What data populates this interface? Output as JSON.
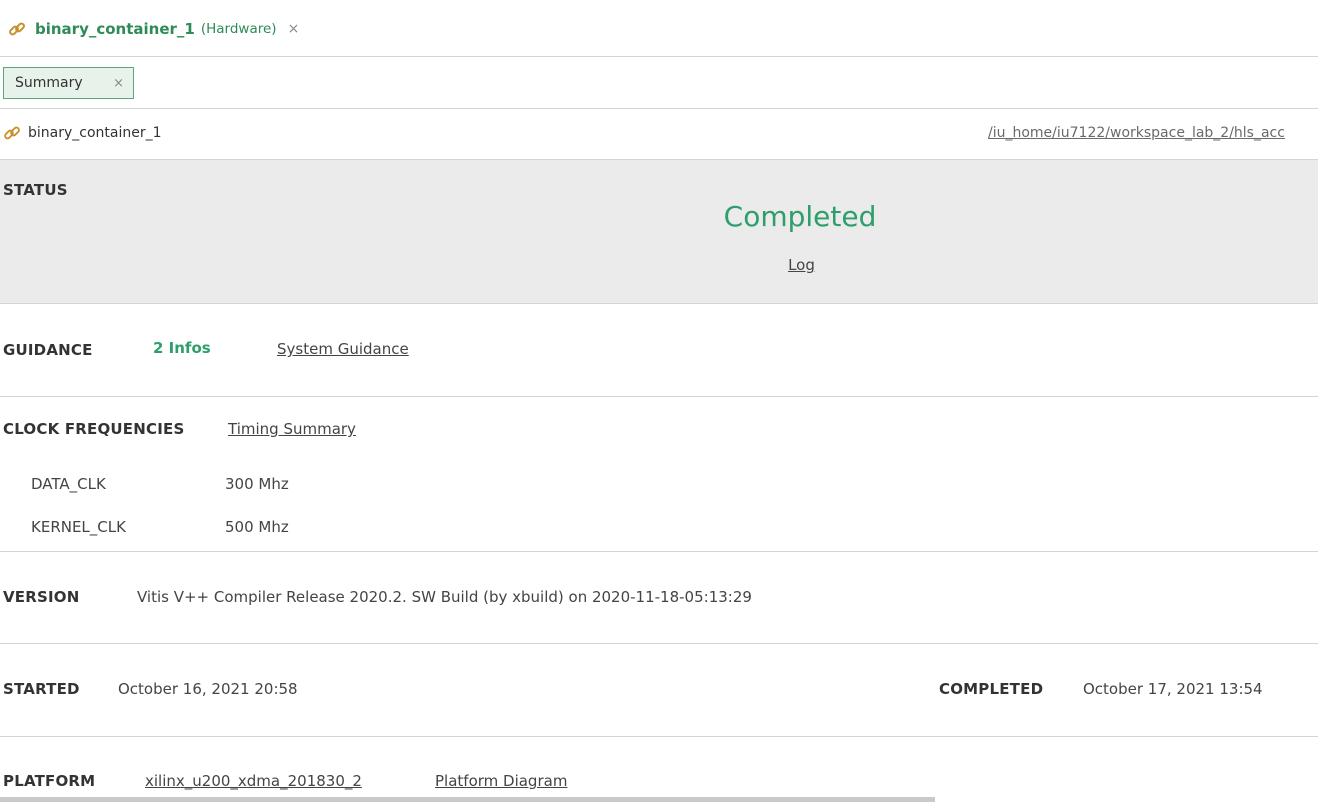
{
  "editor_tab": {
    "title": "binary_container_1",
    "kind": "(Hardware)",
    "close": "×"
  },
  "subtab": {
    "label": "Summary",
    "close": "×"
  },
  "path_row": {
    "name": "binary_container_1",
    "path": "/iu_home/iu7122/workspace_lab_2/hls_acc"
  },
  "status": {
    "label": "STATUS",
    "value": "Completed",
    "log_link": "Log"
  },
  "guidance": {
    "label": "GUIDANCE",
    "infos": "2 Infos",
    "link": "System Guidance"
  },
  "clock": {
    "label": "CLOCK FREQUENCIES",
    "link": "Timing Summary",
    "rows": [
      {
        "name": "DATA_CLK",
        "value": "300 Mhz"
      },
      {
        "name": "KERNEL_CLK",
        "value": "500 Mhz"
      }
    ]
  },
  "version": {
    "label": "VERSION",
    "value": "Vitis V++ Compiler Release 2020.2. SW Build (by xbuild) on 2020-11-18-05:13:29"
  },
  "times": {
    "started_label": "STARTED",
    "started_value": "October 16, 2021 20:58",
    "completed_label": "COMPLETED",
    "completed_value": "October 17, 2021 13:54"
  },
  "platform": {
    "label": "PLATFORM",
    "name": "xilinx_u200_xdma_201830_2",
    "diagram_link": "Platform Diagram"
  },
  "colors": {
    "accent_green": "#2e8b57",
    "status_green": "#2e9e6a",
    "link_icon": "#c8902a"
  },
  "icons": {
    "link": "link-icon"
  }
}
